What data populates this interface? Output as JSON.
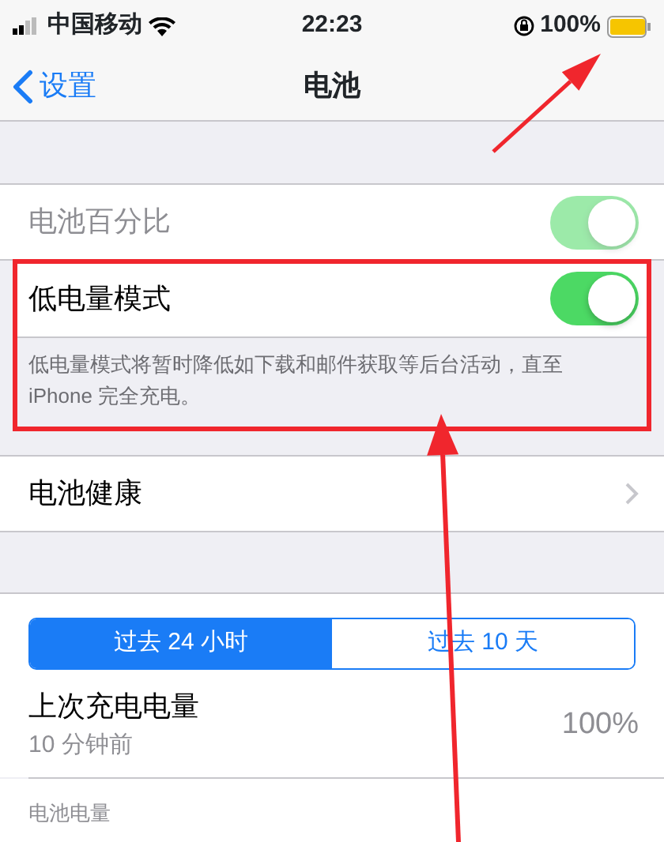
{
  "status_bar": {
    "carrier": "中国移动",
    "time": "22:23",
    "battery_percent": "100%",
    "level": 1
  },
  "nav": {
    "back": "设置",
    "title": "电池"
  },
  "settings": [
    {
      "kind": "toggle",
      "label": "电池百分比",
      "on": true,
      "disabled": true
    },
    {
      "kind": "toggle",
      "label": "低电量模式",
      "on": true,
      "disabled": false,
      "highlighted": true,
      "footer": "低电量模式将暂时降低如下载和邮件获取等后台活动，直至 iPhone 完全充电。"
    },
    {
      "kind": "link",
      "label": "电池健康"
    }
  ],
  "segments": [
    {
      "label": "过去 24 小时",
      "selected": true
    },
    {
      "label": "过去 10 天",
      "selected": false
    }
  ],
  "last_charge": {
    "label": "上次充电电量",
    "subtitle": "10 分钟前",
    "value": "100%"
  },
  "battery_level_label": "电池电量",
  "annotations": [
    {
      "kind": "arrow"
    },
    {
      "kind": "arrow"
    }
  ]
}
